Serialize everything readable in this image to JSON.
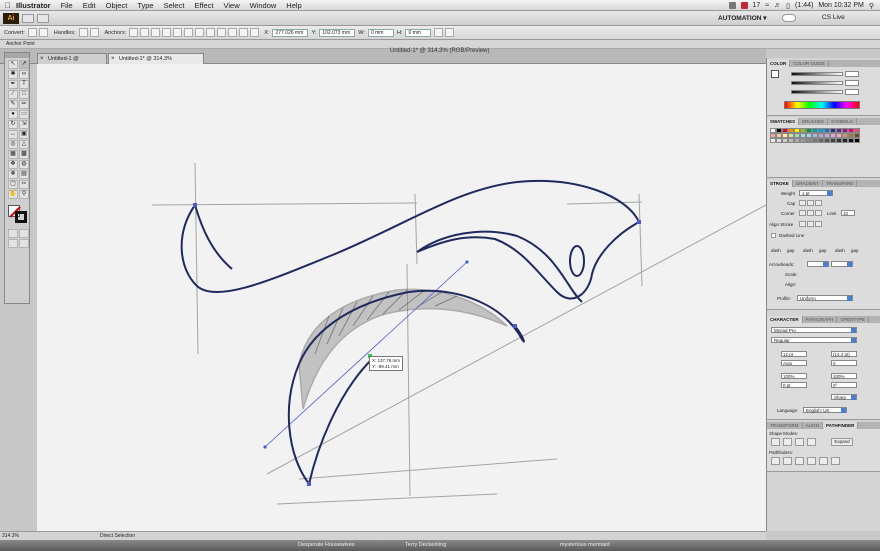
{
  "menubar": {
    "app_name": "Illustrator",
    "items": [
      "File",
      "Edit",
      "Object",
      "Type",
      "Select",
      "Effect",
      "View",
      "Window",
      "Help"
    ],
    "badge": "17",
    "battery": "(1:44)",
    "clock": "Mon 10:32 PM"
  },
  "appbar": {
    "logo": "Ai",
    "workspace": "AUTOMATION ▾",
    "cs_live": "CS Live"
  },
  "control": {
    "convert_label": "Convert:",
    "handles_label": "Handles:",
    "anchors_label": "Anchors:",
    "x_value": "277.026 mm",
    "y_value": "102.073 mm",
    "w_value": "0 mm",
    "h_value": "0 mm"
  },
  "labelstrip": {
    "text": "Anchor Point"
  },
  "document": {
    "tab1": "Untitled-1 @ 33.33% (RGB/Preview)",
    "tab2": "Untitled-1* @ 314.3% (RGB/Preview)",
    "window_title": "Untitled-1* @ 314.3% (RGB/Preview)"
  },
  "tooltip": {
    "dx": "X: 137.76 mm",
    "dy": "Y: -99.41 mm"
  },
  "panels": {
    "color": {
      "tab_active": "COLOR",
      "tab_other": "COLOR GUIDE"
    },
    "swatches": {
      "tab_active": "SWATCHES",
      "tab_2": "BRUSHES",
      "tab_3": "SYMBOLS"
    },
    "stroke": {
      "tab_active": "STROKE",
      "tab_2": "GRADIENT",
      "tab_3": "TRANSPARE",
      "weight_label": "Weight",
      "weight_value": "1 pt",
      "cap_label": "Cap",
      "corner_label": "Corner",
      "limit_label": "Limit",
      "limit_value": "10",
      "align_label": "Align Stroke",
      "dashed_label": "Dashed Line",
      "dash_labels": [
        "dash",
        "gap",
        "dash",
        "gap",
        "dash",
        "gap"
      ],
      "arrowheads_label": "Arrowheads:",
      "scale_label": "Scale:",
      "align_arrow_label": "Align:",
      "profile_label": "Profile:",
      "profile_value": "Uniform"
    },
    "character": {
      "tab_active": "CHARACTER",
      "tab_2": "PARAGRAPH",
      "tab_3": "OPENTYPE",
      "font": "Myriad Pro",
      "style": "Regular",
      "size": "12 pt",
      "leading": "(14.4 pt)",
      "kerning": "Auto",
      "tracking": "0",
      "hscale": "100%",
      "vscale": "100%",
      "baseline": "0 pt",
      "rotation": "0°",
      "antialias": "Sharp",
      "language_label": "Language:",
      "language": "English: UK"
    },
    "pathfinder": {
      "tab_1": "TRANSFORM",
      "tab_2": "ALIGN",
      "tab_active": "PATHFINDER",
      "shape_modes": "Shape Modes:",
      "expand": "Expand",
      "pathfinders": "Pathfinders:"
    }
  },
  "status": {
    "zoom": "314.3%",
    "tool": "Direct Selection"
  },
  "dock": {
    "items": [
      "Desperate Housewives",
      "Terry Deckerking",
      "mysterious mermaid"
    ]
  },
  "colors": {
    "path": "#1f2a5e",
    "guide": "#4a5bd6",
    "sketch": "#6e6e6e",
    "canvas": "#f2f2f2"
  }
}
